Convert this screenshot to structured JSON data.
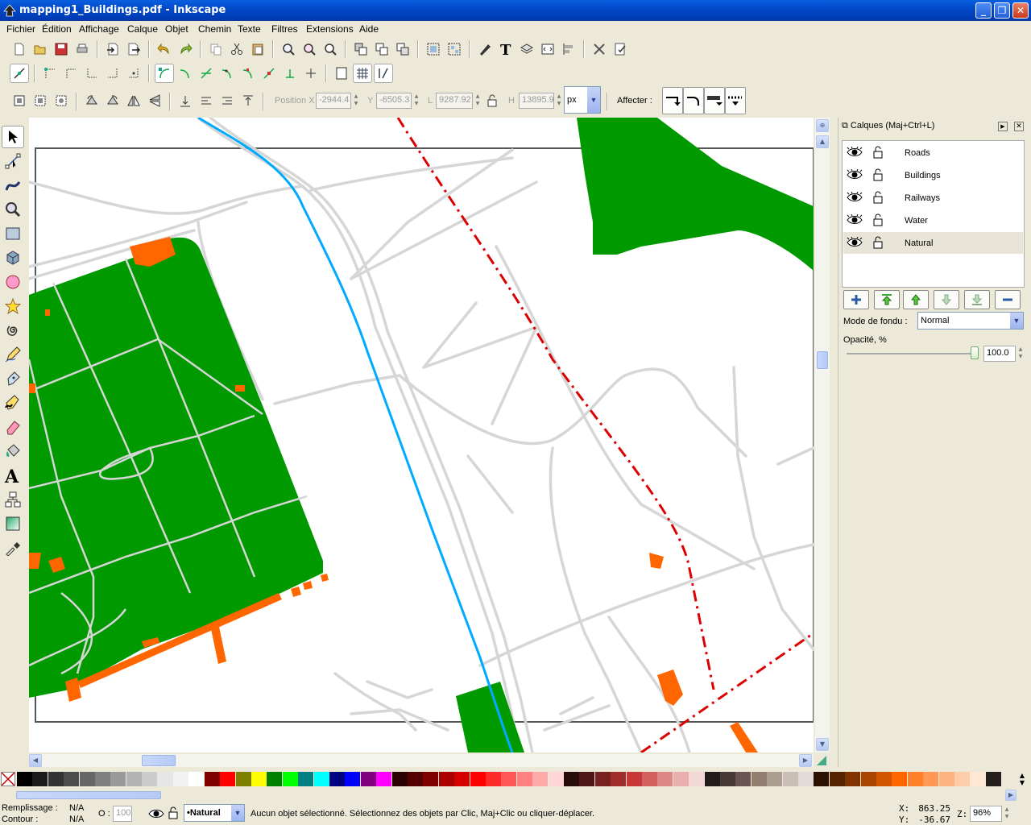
{
  "window": {
    "title": "mapping1_Buildings.pdf - Inkscape"
  },
  "menu": [
    "Fichier",
    "Édition",
    "Affichage",
    "Calque",
    "Objet",
    "Chemin",
    "Texte",
    "Filtres",
    "Extensions",
    "Aide"
  ],
  "selector_toolbar": {
    "position_x_label": "Position X",
    "x_value": "-2944.4",
    "y_label": "Y",
    "y_value": "-6505.3",
    "w_label": "L",
    "w_value": "9287.92",
    "h_label": "H",
    "h_value": "13895.9",
    "unit": "px",
    "affect_label": "Affecter :"
  },
  "layers_panel": {
    "title": "Calques (Maj+Ctrl+L)",
    "layers": [
      "Roads",
      "Buildings",
      "Railways",
      "Water",
      "Natural"
    ],
    "selected_layer": "Natural",
    "blend_label": "Mode de fondu :",
    "blend_value": "Normal",
    "opacity_label": "Opacité, %",
    "opacity_value": "100.0"
  },
  "status": {
    "fill_label": "Remplissage :",
    "fill_value": "N/A",
    "stroke_label": "Contour :",
    "stroke_value": "N/A",
    "opacity_label": "O :",
    "opacity_value": "100",
    "layer": "•Natural",
    "message": "Aucun objet sélectionné. Sélectionnez des objets par Clic, Maj+Clic ou cliquer-déplacer.",
    "x_label": "X:",
    "x": "863.25",
    "y_label": "Y:",
    "y": "-36.67",
    "zoom_label": "Z:",
    "zoom": "96%"
  },
  "colors": {
    "natural_green": "#009900",
    "building_orange": "#ff6600",
    "water_blue": "#00aaff",
    "railway_red": "#dd0000",
    "road_gray": "#d6d6d6"
  },
  "palette": [
    "#000000",
    "#1a1a1a",
    "#333333",
    "#4d4d4d",
    "#666666",
    "#808080",
    "#999999",
    "#b3b3b3",
    "#cccccc",
    "#e6e6e6",
    "#f2f2f2",
    "#ffffff",
    "#800000",
    "#ff0000",
    "#808000",
    "#ffff00",
    "#008000",
    "#00ff00",
    "#008080",
    "#00ffff",
    "#000080",
    "#0000ff",
    "#800080",
    "#ff00ff",
    "#2b0000",
    "#550000",
    "#800000",
    "#aa0000",
    "#d40000",
    "#ff0000",
    "#ff2a2a",
    "#ff5555",
    "#ff8080",
    "#ffaaaa",
    "#ffd5d5",
    "#280b0b",
    "#501616",
    "#782121",
    "#a02c2c",
    "#c83737",
    "#d35f5f",
    "#de8787",
    "#e9afaf",
    "#f4d7d7",
    "#241c1c",
    "#483737",
    "#6c5353",
    "#917c6f",
    "#ac9d93",
    "#c8beb7",
    "#e3dbdb",
    "#2b1100",
    "#552200",
    "#803300",
    "#aa4400",
    "#d45500",
    "#ff6600",
    "#ff7f2a",
    "#ff9955",
    "#ffb380",
    "#ffccaa",
    "#ffe6d5",
    "#241f1c"
  ]
}
